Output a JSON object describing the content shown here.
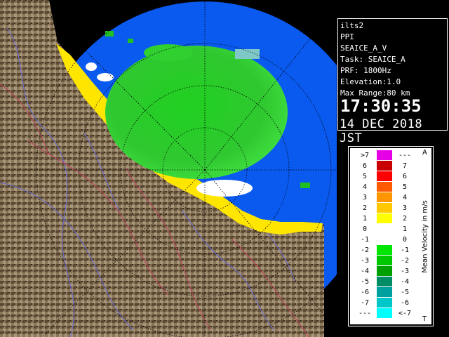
{
  "info_panel": {
    "site": "ilts2",
    "scan": "PPI",
    "task_name": "SEAICE_A_V",
    "task": "Task: SEAICE_A",
    "prf": "PRF: 1800Hz",
    "elevation": "Elevation:1.0",
    "max_range": "Max Range:80 km",
    "time": "17:30:35",
    "date": "14 DEC 2018 JST"
  },
  "legend": {
    "title": "Mean Velocity in m/s",
    "top_mark": "A",
    "bottom_mark": "T",
    "rows": [
      {
        "lo": ">7",
        "hi": "---",
        "color": "#e600e6"
      },
      {
        "lo": "6",
        "hi": "7",
        "color": "#c80000"
      },
      {
        "lo": "5",
        "hi": "6",
        "color": "#ff0000"
      },
      {
        "lo": "4",
        "hi": "5",
        "color": "#ff5a00"
      },
      {
        "lo": "3",
        "hi": "4",
        "color": "#ff9600"
      },
      {
        "lo": "2",
        "hi": "3",
        "color": "#ffc800"
      },
      {
        "lo": "1",
        "hi": "2",
        "color": "#ffff00"
      },
      {
        "lo": "0",
        "hi": "1",
        "color": "#ffffff"
      },
      {
        "lo": "-1",
        "hi": "0",
        "color": "#ffffff"
      },
      {
        "lo": "-2",
        "hi": "-1",
        "color": "#00e600"
      },
      {
        "lo": "-3",
        "hi": "-2",
        "color": "#00c800"
      },
      {
        "lo": "-4",
        "hi": "-3",
        "color": "#00a000"
      },
      {
        "lo": "-5",
        "hi": "-4",
        "color": "#008c64"
      },
      {
        "lo": "-6",
        "hi": "-5",
        "color": "#00a0a0"
      },
      {
        "lo": "-7",
        "hi": "-6",
        "color": "#00c8c8"
      },
      {
        "lo": "---",
        "hi": "<-7",
        "color": "#00ffff"
      }
    ]
  },
  "colors": {
    "background": "#000000",
    "sea": "#0050ff",
    "land": "#8a7658",
    "green_echo": "#28d228",
    "yellow_echo": "#ffe600"
  }
}
